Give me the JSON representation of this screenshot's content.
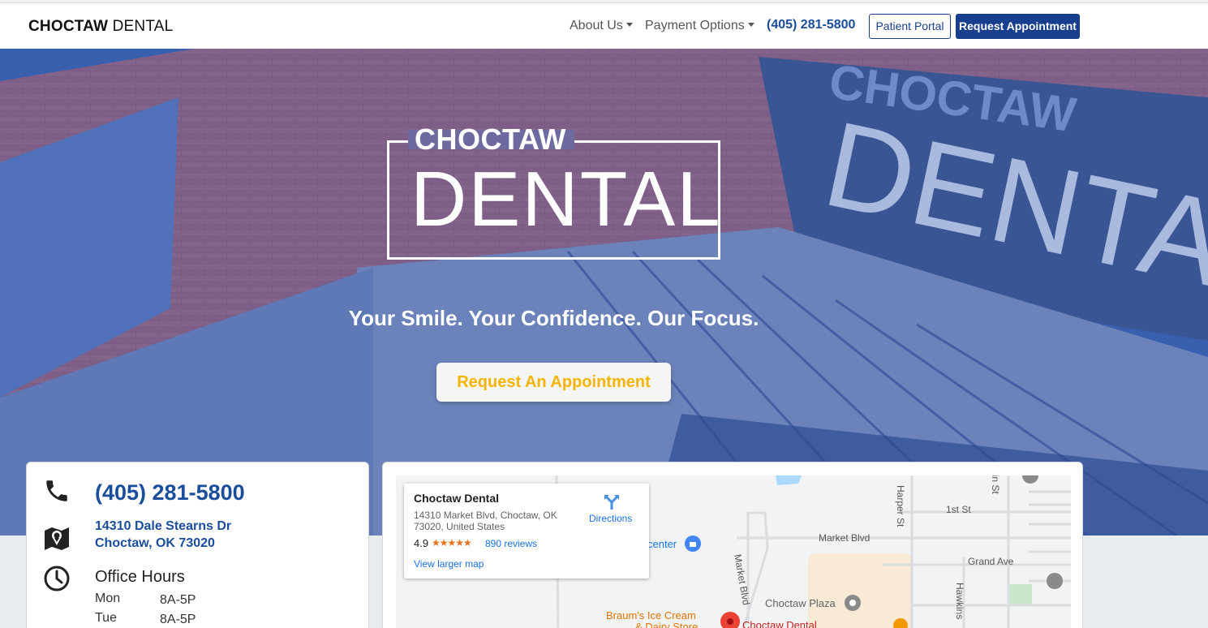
{
  "header": {
    "brand_bold": "CHOCTAW",
    "brand_light": "DENTAL",
    "nav": [
      {
        "label": "About Us"
      },
      {
        "label": "Payment Options"
      }
    ],
    "phone": "(405) 281-5800",
    "portal_label": "Patient Portal",
    "request_label": "Request Appointment"
  },
  "hero": {
    "logo_top": "CHOCTAW",
    "logo_main": "DENTAL",
    "tagline": "Your Smile. Your Confidence. Our Focus.",
    "cta_label": "Request An Appointment",
    "cta_color": "#f4b400"
  },
  "info": {
    "phone": "(405) 281-5800",
    "address_line1": "14310 Dale Stearns Dr",
    "address_line2": "Choctaw, OK 73020",
    "hours_title": "Office Hours",
    "hours": [
      {
        "day": "Mon",
        "time": "8A-5P"
      },
      {
        "day": "Tue",
        "time": "8A-5P"
      }
    ]
  },
  "map": {
    "popup": {
      "title": "Choctaw Dental",
      "address": "14310 Market Blvd, Choctaw, OK 73020, United States",
      "rating": "4.9",
      "stars": "★★★★★",
      "reviews": "890 reviews",
      "directions": "Directions",
      "larger_map": "View larger map"
    },
    "labels": {
      "harper": "Harper St",
      "first": "1st St",
      "market": "Market Blvd",
      "market_vertical": "Market Blvd",
      "grand": "Grand Ave",
      "plaza": "Choctaw Plaza",
      "center": "center",
      "hawkins": "Hawkins",
      "braums1": "Braum's Ice Cream",
      "braums2": "& Dairy Store",
      "pin": "Choctaw Dental",
      "ain": "ain St"
    }
  },
  "colors": {
    "primary": "#173f8e",
    "link_blue": "#1a4d9c"
  }
}
